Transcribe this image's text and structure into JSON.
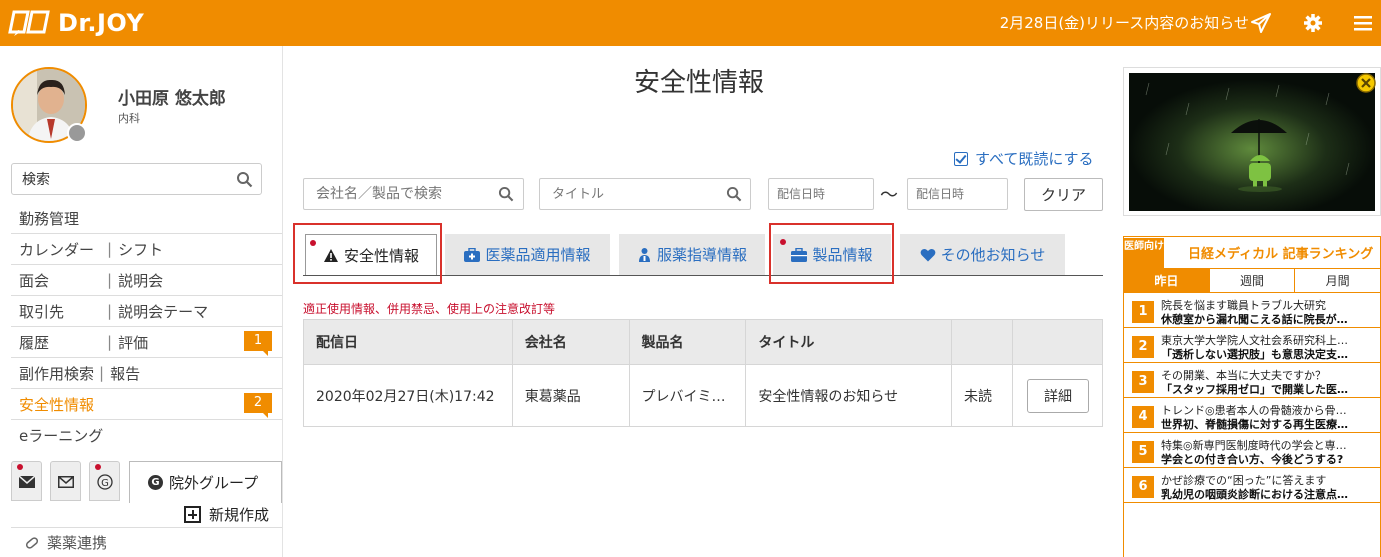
{
  "header": {
    "logo": "Dr.JOY",
    "release_notice": "2月28日(金)リリース内容のお知らせ",
    "icons": [
      "paper-plane-icon",
      "gear-icon",
      "hamburger-menu-icon"
    ],
    "brand_color": "#f08c00"
  },
  "user": {
    "name": "小田原 悠太郎",
    "department": "内科"
  },
  "sidebar": {
    "search_value": "検索",
    "menu": [
      {
        "left": "勤務管理",
        "right": "",
        "badge": ""
      },
      {
        "left": "カレンダー",
        "right": "シフト",
        "badge": ""
      },
      {
        "left": "面会",
        "right": "説明会",
        "badge": ""
      },
      {
        "left": "取引先",
        "right": "説明会テーマ",
        "badge": ""
      },
      {
        "left": "履歴",
        "right": "評価",
        "badge": "1"
      },
      {
        "left": "副作用検索",
        "right": "報告",
        "badge": ""
      },
      {
        "left": "安全性情報",
        "right": "",
        "badge": "2"
      },
      {
        "left": "eラーニング",
        "right": "",
        "badge": ""
      }
    ],
    "group_tab": "院外グループ",
    "group_icon_letter": "G",
    "new_create": "新規作成",
    "bottom_item": "薬薬連携"
  },
  "main": {
    "title": "安全性情報",
    "mark_all_read": "すべて既読にする",
    "filters": {
      "company_placeholder": "会社名／製品で検索",
      "title_placeholder": "タイトル",
      "date_from_placeholder": "配信日時",
      "date_to_placeholder": "配信日時",
      "range_separator": "〜",
      "clear": "クリア"
    },
    "tabs": [
      {
        "label": "安全性情報",
        "icon": "warning-icon"
      },
      {
        "label": "医薬品適用情報",
        "icon": "medical-kit-icon"
      },
      {
        "label": "服薬指導情報",
        "icon": "users-icon"
      },
      {
        "label": "製品情報",
        "icon": "briefcase-icon"
      },
      {
        "label": "その他お知らせ",
        "icon": "heart-icon"
      }
    ],
    "note": "適正使用情報、併用禁忌、使用上の注意改訂等",
    "table": {
      "headers": [
        "配信日",
        "会社名",
        "製品名",
        "タイトル",
        "",
        ""
      ],
      "rows": [
        {
          "date": "2020年02月27日(木)17:42",
          "company": "東葛薬品",
          "product": "プレバイミ…",
          "title": "安全性情報のお知らせ",
          "status": "未読",
          "action": "詳細"
        }
      ]
    }
  },
  "ranking": {
    "tag": "医師向け",
    "title": "日経メディカル 記事ランキング",
    "tabs": [
      "昨日",
      "週間",
      "月間"
    ],
    "items": [
      {
        "num": "1",
        "line1": "院長を悩ます職員トラブル大研究",
        "line2": "休憩室から漏れ聞こえる話に院長が…"
      },
      {
        "num": "2",
        "line1": "東京大学大学院人文社会系研究科上…",
        "line2": "「透析しない選択肢」も意思決定支…"
      },
      {
        "num": "3",
        "line1": "その開業、本当に大丈夫ですか？",
        "line2": "「スタッフ採用ゼロ」で開業した医…"
      },
      {
        "num": "4",
        "line1": "トレンド◎患者本人の骨髄液から骨…",
        "line2": "世界初、脊髄損傷に対する再生医療…"
      },
      {
        "num": "5",
        "line1": "特集◎新専門医制度時代の学会と専…",
        "line2": "学会との付き合い方、今後どうする?"
      },
      {
        "num": "6",
        "line1": "かぜ診療での“困った”に答えます",
        "line2": "乳幼児の咽頭炎診断における注意点…"
      }
    ]
  }
}
